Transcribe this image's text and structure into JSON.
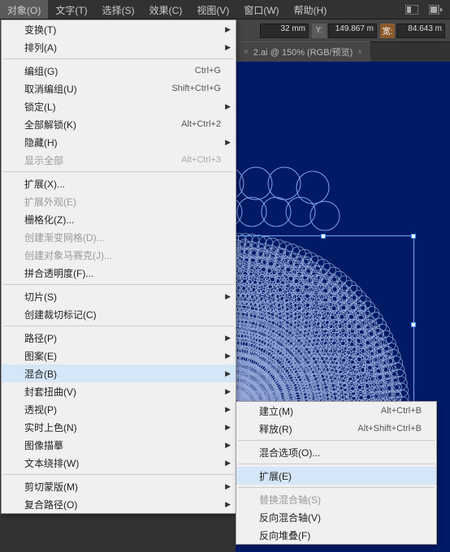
{
  "menubar": {
    "items": [
      "对象(O)",
      "文字(T)",
      "选择(S)",
      "效果(C)",
      "视图(V)",
      "窗口(W)",
      "帮助(H)"
    ]
  },
  "toolbar": {
    "y_value": "32 mm",
    "y2_label": "Y:",
    "y2_value": "149.867 m",
    "w_label": "宽:",
    "w_value": "84.643 m"
  },
  "tab": {
    "prefix": "",
    "label": "2.ai @ 150% (RGB/预览)"
  },
  "dropdown": [
    {
      "label": "变换(T)",
      "sub": true
    },
    {
      "label": "排列(A)",
      "sub": true
    },
    {
      "sep": true
    },
    {
      "label": "编组(G)",
      "shortcut": "Ctrl+G"
    },
    {
      "label": "取消编组(U)",
      "shortcut": "Shift+Ctrl+G"
    },
    {
      "label": "锁定(L)",
      "sub": true
    },
    {
      "label": "全部解锁(K)",
      "shortcut": "Alt+Ctrl+2"
    },
    {
      "label": "隐藏(H)",
      "sub": true
    },
    {
      "label": "显示全部",
      "shortcut": "Alt+Ctrl+3",
      "disabled": true
    },
    {
      "sep": true
    },
    {
      "label": "扩展(X)..."
    },
    {
      "label": "扩展外观(E)",
      "disabled": true
    },
    {
      "label": "栅格化(Z)..."
    },
    {
      "label": "创建渐变网格(D)...",
      "disabled": true
    },
    {
      "label": "创建对象马赛克(J)...",
      "disabled": true
    },
    {
      "label": "拼合透明度(F)..."
    },
    {
      "sep": true
    },
    {
      "label": "切片(S)",
      "sub": true
    },
    {
      "label": "创建裁切标记(C)"
    },
    {
      "sep": true
    },
    {
      "label": "路径(P)",
      "sub": true
    },
    {
      "label": "图案(E)",
      "sub": true
    },
    {
      "label": "混合(B)",
      "sub": true,
      "hover": true
    },
    {
      "label": "封套扭曲(V)",
      "sub": true
    },
    {
      "label": "透视(P)",
      "sub": true
    },
    {
      "label": "实时上色(N)",
      "sub": true
    },
    {
      "label": "图像描摹",
      "sub": true
    },
    {
      "label": "文本绕排(W)",
      "sub": true
    },
    {
      "sep": true
    },
    {
      "label": "剪切蒙版(M)",
      "sub": true
    },
    {
      "label": "复合路径(O)",
      "sub": true
    }
  ],
  "submenu": [
    {
      "label": "建立(M)",
      "shortcut": "Alt+Ctrl+B"
    },
    {
      "label": "释放(R)",
      "shortcut": "Alt+Shift+Ctrl+B"
    },
    {
      "sep": true
    },
    {
      "label": "混合选项(O)..."
    },
    {
      "sep": true
    },
    {
      "label": "扩展(E)",
      "hover": true
    },
    {
      "sep": true
    },
    {
      "label": "替换混合轴(S)",
      "disabled": true
    },
    {
      "label": "反向混合轴(V)"
    },
    {
      "label": "反向堆叠(F)"
    }
  ]
}
